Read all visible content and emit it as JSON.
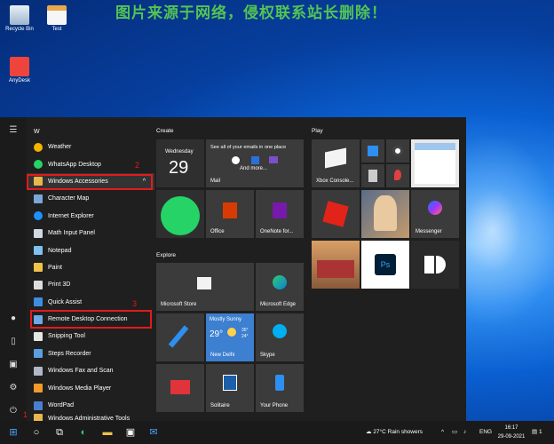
{
  "banner": "图片来源于网络，侵权联系站长删除！",
  "desktop": {
    "icons": [
      "Recycle Bin",
      "Test",
      "AnyDesk"
    ]
  },
  "start_menu": {
    "letter": "W",
    "apps": [
      "Weather",
      "WhatsApp Desktop",
      "Windows Accessories",
      "Character Map",
      "Internet Explorer",
      "Math Input Panel",
      "Notepad",
      "Paint",
      "Print 3D",
      "Quick Assist",
      "Remote Desktop Connection",
      "Snipping Tool",
      "Steps Recorder",
      "Windows Fax and Scan",
      "Windows Media Player",
      "WordPad",
      "Windows Administrative Tools"
    ],
    "annotations": [
      "1",
      "2",
      "3"
    ],
    "groups": {
      "create": "Create",
      "explore": "Explore",
      "play": "Play"
    },
    "tiles": {
      "calendar_day": "Wednesday",
      "calendar_date": "29",
      "mail_headline": "See all of your emails in one place",
      "mail_more": "And more...",
      "mail": "Mail",
      "office": "Office",
      "onenote": "OneNote for...",
      "xbox": "Xbox Console...",
      "messenger": "Messenger",
      "store": "Microsoft Store",
      "edge": "Microsoft Edge",
      "weather_condition": "Mostly Sunny",
      "weather_temp": "29°",
      "weather_hi": "35°",
      "weather_lo": "24°",
      "weather_city": "New Delhi",
      "skype": "Skype",
      "solitaire": "Solitaire",
      "phone": "Your Phone"
    }
  },
  "taskbar": {
    "weather": "27°C  Rain showers",
    "lang": "ENG",
    "time": "16:17",
    "date": "29-09-2021",
    "notif": "1"
  },
  "colors": {
    "accent": "#0a5fd0",
    "annotation": "#e21b1b"
  }
}
